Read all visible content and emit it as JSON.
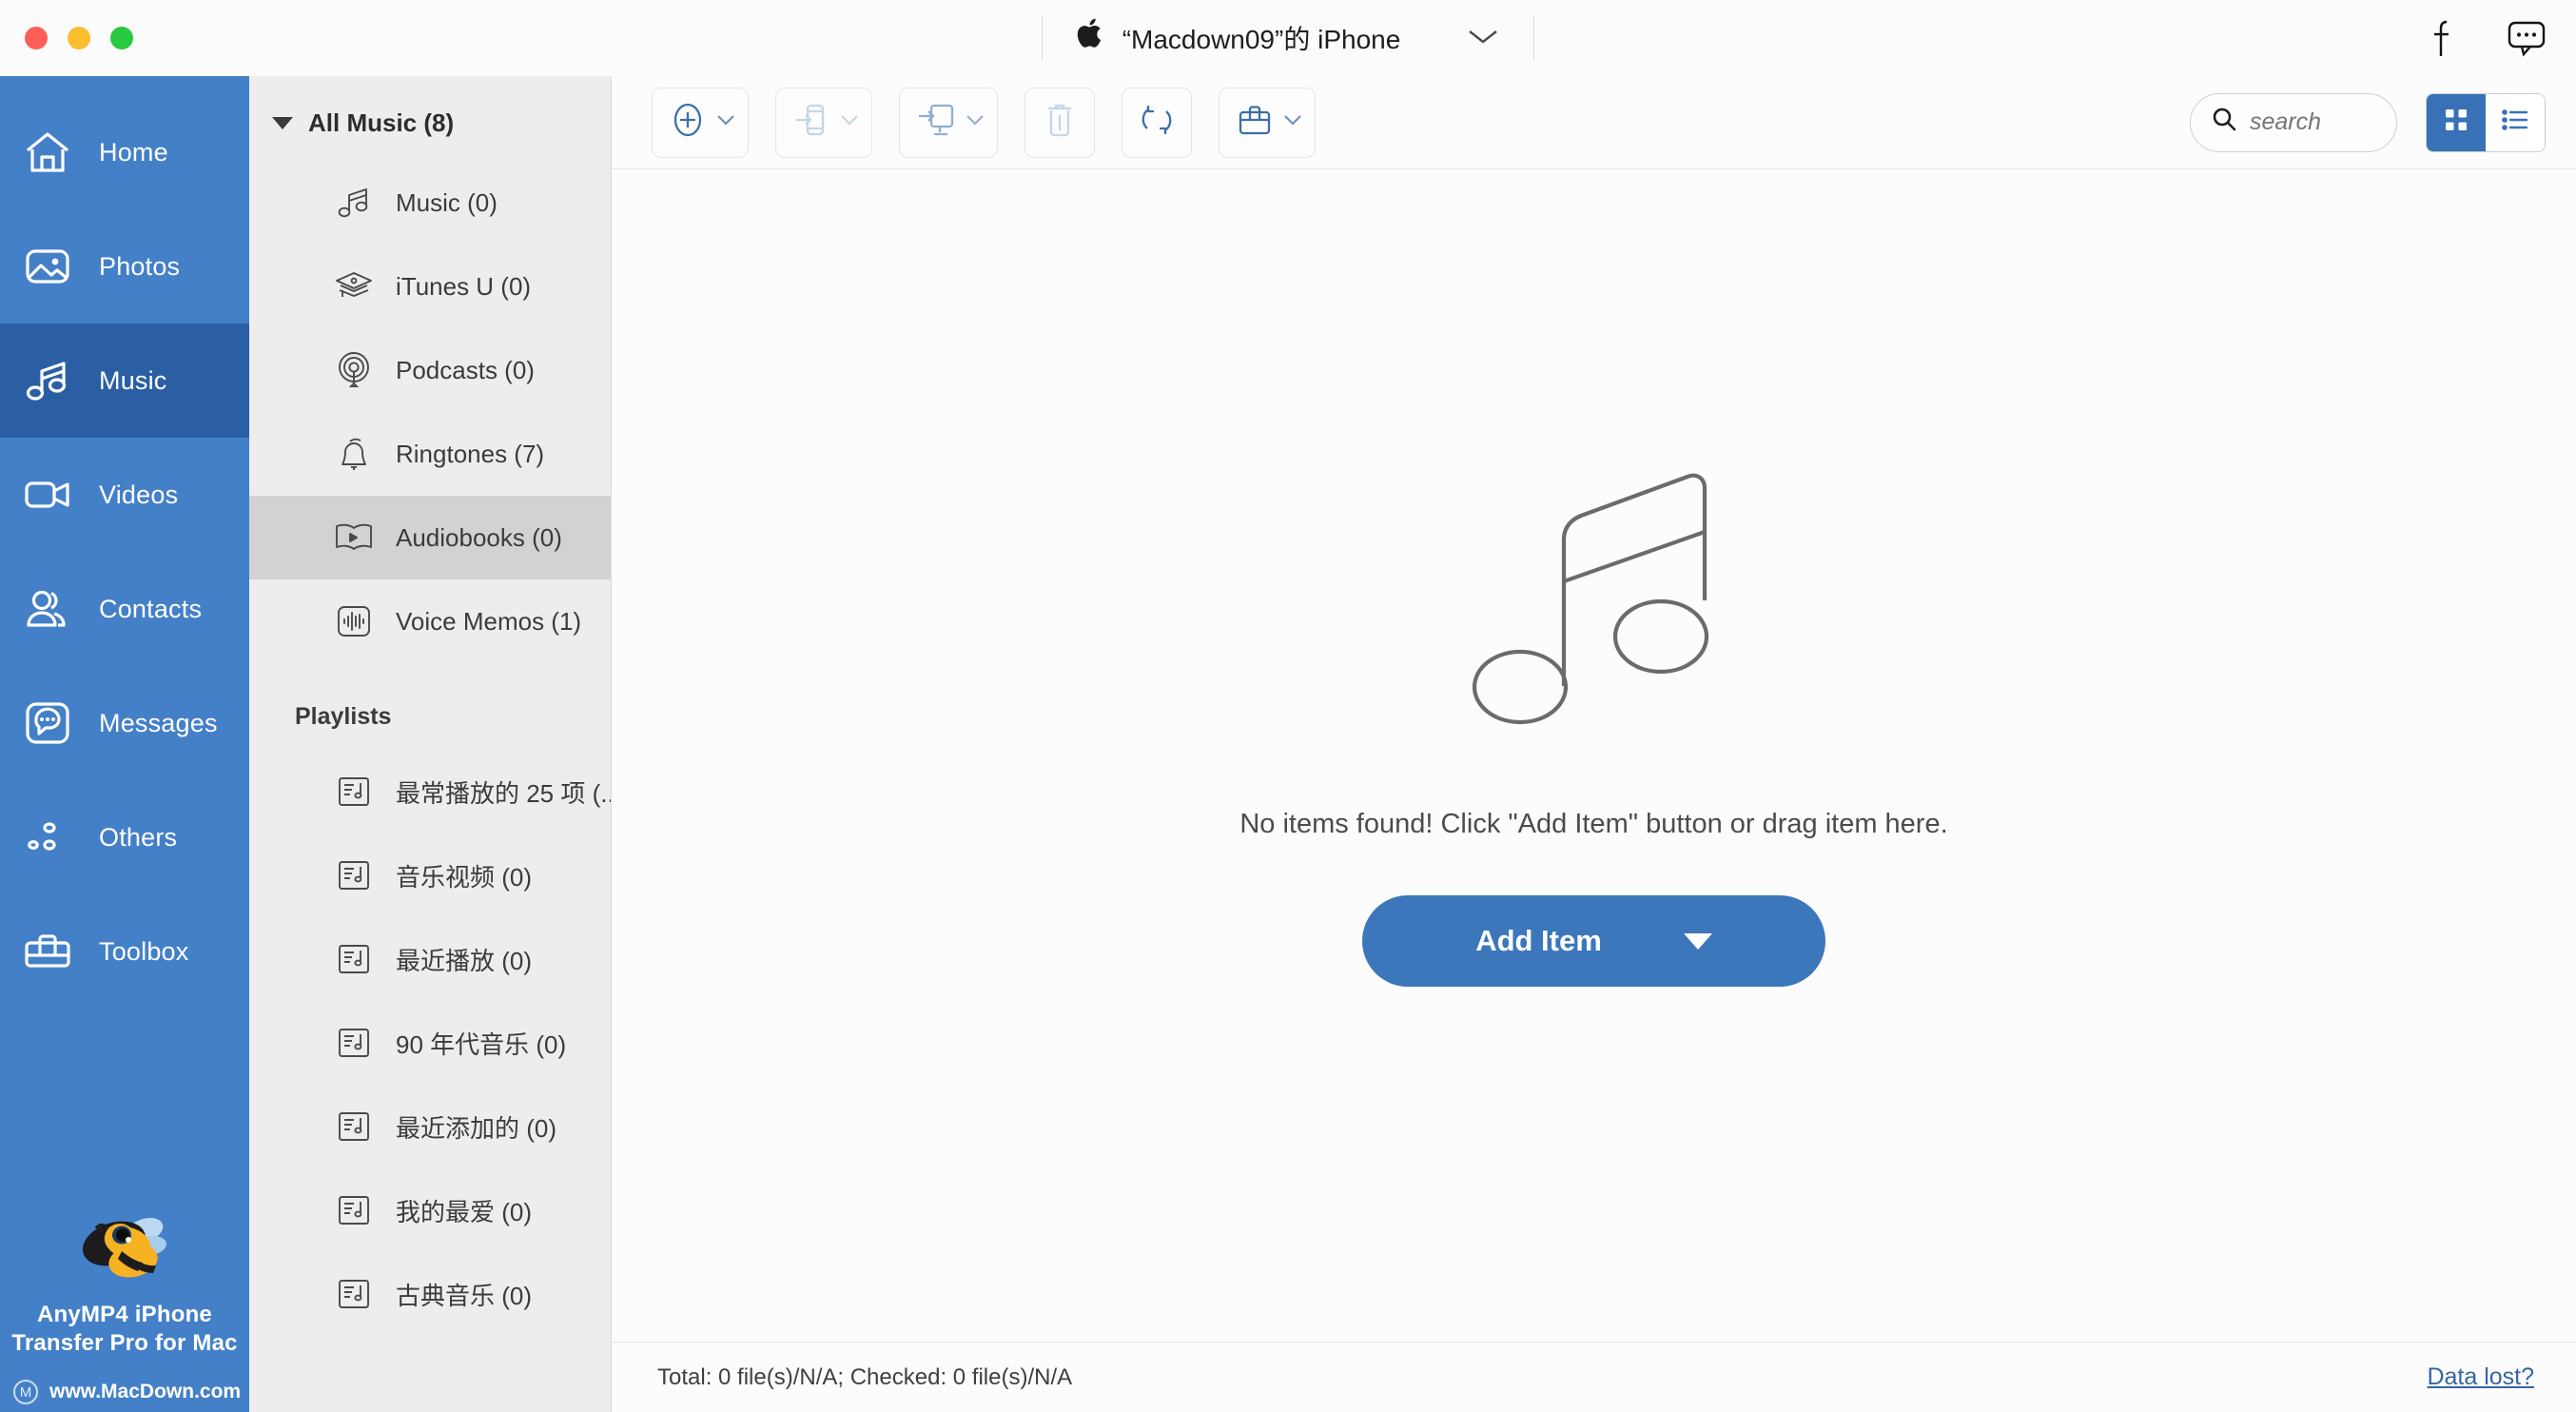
{
  "titlebar": {
    "traffic_lights": [
      "close",
      "minimize",
      "maximize"
    ],
    "apple_glyph": "",
    "device_name": "“Macdown09”的 iPhone",
    "device_dropdown_icon": "chevron-down-icon",
    "right_icons": [
      "facebook-icon",
      "feedback-icon"
    ],
    "colors": {
      "close": "#FC5F57",
      "minimize": "#FBBE2E",
      "maximize": "#28C840"
    }
  },
  "sidebar": {
    "items": [
      {
        "label": "Home",
        "icon": "home-icon",
        "selected": false
      },
      {
        "label": "Photos",
        "icon": "photos-icon",
        "selected": false
      },
      {
        "label": "Music",
        "icon": "music-note-icon",
        "selected": true
      },
      {
        "label": "Videos",
        "icon": "video-camera-icon",
        "selected": false
      },
      {
        "label": "Contacts",
        "icon": "contacts-icon",
        "selected": false
      },
      {
        "label": "Messages",
        "icon": "message-bubble-icon",
        "selected": false
      },
      {
        "label": "Others",
        "icon": "others-dots-icon",
        "selected": false
      },
      {
        "label": "Toolbox",
        "icon": "toolbox-icon",
        "selected": false
      }
    ],
    "brand": {
      "logo": "bee-logo",
      "name_line1": "AnyMP4 iPhone",
      "name_line2": "Transfer Pro for Mac",
      "site_mark": "M",
      "site": "www.MacDown.com"
    },
    "colors": {
      "background": "#4480C8",
      "selected": "#2B5FA3",
      "text": "#FFFFFF"
    }
  },
  "category_panel": {
    "header": {
      "label": "All Music (8)",
      "expanded": true,
      "icon": "caret-down-icon"
    },
    "categories": [
      {
        "label": "Music (0)",
        "icon": "music-note-icon",
        "active": false
      },
      {
        "label": "iTunes U (0)",
        "icon": "graduation-cap-icon",
        "active": false
      },
      {
        "label": "Podcasts (0)",
        "icon": "podcast-icon",
        "active": false
      },
      {
        "label": "Ringtones (7)",
        "icon": "bell-icon",
        "active": false
      },
      {
        "label": "Audiobooks (0)",
        "icon": "audiobook-icon",
        "active": true
      },
      {
        "label": "Voice Memos (1)",
        "icon": "waveform-icon",
        "active": false
      }
    ],
    "playlists_header": "Playlists",
    "playlists": [
      {
        "label": "最常播放的 25 项 (...",
        "icon": "playlist-icon"
      },
      {
        "label": "音乐视频 (0)",
        "icon": "playlist-icon"
      },
      {
        "label": "最近播放 (0)",
        "icon": "playlist-icon"
      },
      {
        "label": "90 年代音乐 (0)",
        "icon": "playlist-icon"
      },
      {
        "label": "最近添加的 (0)",
        "icon": "playlist-icon"
      },
      {
        "label": "我的最爱 (0)",
        "icon": "playlist-icon"
      },
      {
        "label": "古典音乐 (0)",
        "icon": "playlist-icon"
      }
    ],
    "colors": {
      "background": "#EDEDED",
      "active_row": "#D2D2D2"
    }
  },
  "toolbar": {
    "buttons": [
      {
        "name": "add-item",
        "icon": "plus-circle-icon",
        "has_dropdown": true,
        "disabled": false
      },
      {
        "name": "export-to-device",
        "icon": "export-to-phone-icon",
        "has_dropdown": true,
        "disabled": true
      },
      {
        "name": "export-to-mac",
        "icon": "export-to-mac-icon",
        "has_dropdown": true,
        "disabled": false
      },
      {
        "name": "delete",
        "icon": "trash-icon",
        "has_dropdown": false,
        "disabled": true
      },
      {
        "name": "refresh",
        "icon": "refresh-icon",
        "has_dropdown": false,
        "disabled": false
      },
      {
        "name": "toolbox",
        "icon": "toolbox-icon",
        "has_dropdown": true,
        "disabled": false
      }
    ],
    "search": {
      "placeholder": "search",
      "value": "",
      "icon": "search-icon"
    },
    "view_toggle": {
      "grid_active": true,
      "list_active": false,
      "grid_icon": "grid-view-icon",
      "list_icon": "list-view-icon"
    },
    "accent": "#3871B5"
  },
  "content": {
    "illustration": "music-note-outline-illustration",
    "empty_message": "No items found! Click \"Add Item\" button or drag item here.",
    "add_button": {
      "label": "Add Item",
      "dropdown_icon": "triangle-down-icon",
      "color": "#3C77BC"
    }
  },
  "statusbar": {
    "status": "Total: 0 file(s)/N/A; Checked: 0 file(s)/N/A",
    "link": "Data lost?",
    "link_color": "#3565A8"
  }
}
